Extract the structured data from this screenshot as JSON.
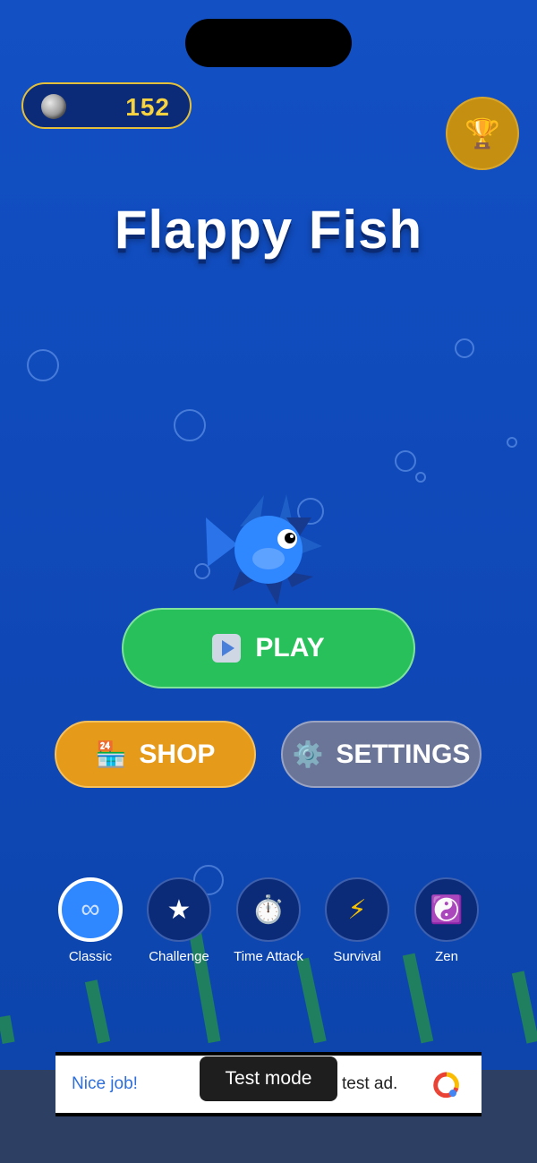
{
  "status": {
    "coins": "152"
  },
  "title": "Flappy Fish",
  "buttons": {
    "play": "PLAY",
    "shop": "SHOP",
    "settings": "SETTINGS"
  },
  "icons": {
    "trophy": "🏆",
    "shop": "🏪",
    "settings": "⚙️",
    "coin": "coin-icon",
    "play": "play-icon"
  },
  "modes": [
    {
      "label": "Classic",
      "icon": "∞",
      "active": true
    },
    {
      "label": "Challenge",
      "icon": "★",
      "active": false
    },
    {
      "label": "Time Attack",
      "icon": "⏱️",
      "active": false
    },
    {
      "label": "Survival",
      "icon": "⚡",
      "active": false
    },
    {
      "label": "Zen",
      "icon": "☯️",
      "active": false
    }
  ],
  "ad": {
    "left_text": "Nice job!",
    "right_text": "test ad.",
    "toast": "Test mode"
  },
  "colors": {
    "background": "#1250c4",
    "play": "#27c05a",
    "shop": "#e69a1a",
    "settings": "#6b7597",
    "coin_text": "#f6d33f",
    "fish": "#2f88ff"
  }
}
